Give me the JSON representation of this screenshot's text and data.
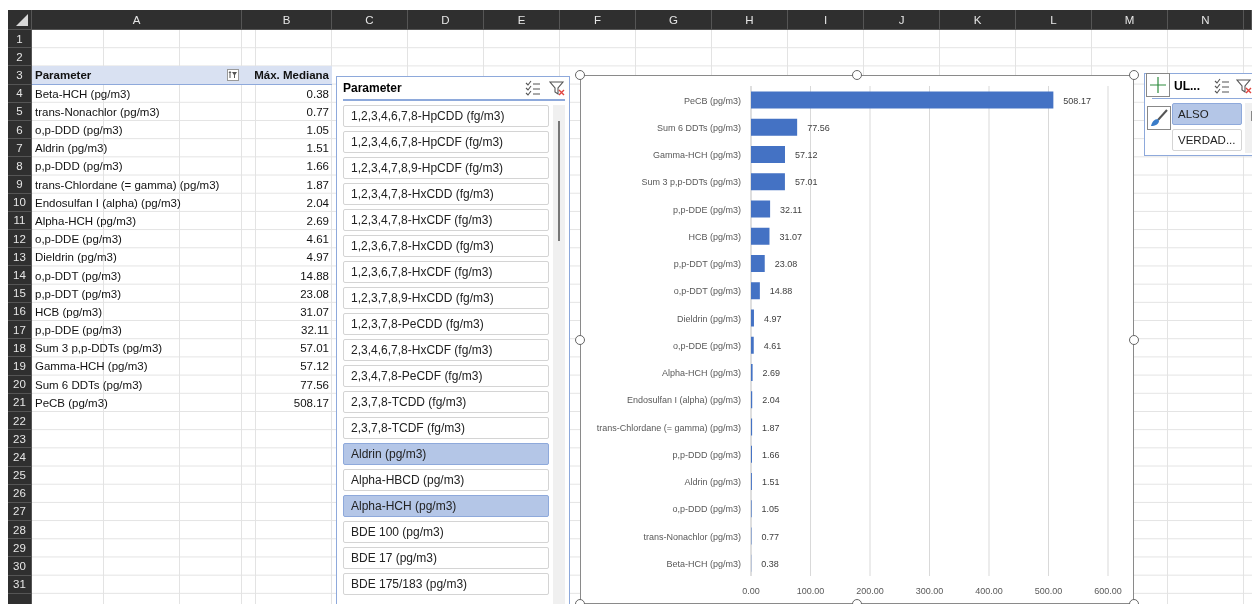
{
  "sheet": {
    "columns": [
      "A",
      "B",
      "C",
      "D",
      "E",
      "F",
      "G",
      "H",
      "I",
      "J",
      "K",
      "L",
      "M",
      "N"
    ],
    "row_numbers": [
      "1",
      "2",
      "3",
      "4",
      "5",
      "6",
      "7",
      "8",
      "9",
      "10",
      "11",
      "12",
      "13",
      "14",
      "15",
      "16",
      "17",
      "18",
      "19",
      "20",
      "21",
      "22",
      "23",
      "24",
      "25",
      "26",
      "27",
      "28",
      "29",
      "30",
      "31"
    ]
  },
  "table": {
    "columns": [
      {
        "label": "Parameter",
        "filter_button": true
      },
      {
        "label": "Máx. Mediana",
        "filter_button": false
      }
    ],
    "rows": [
      [
        "Beta-HCH (pg/m3)",
        "0.38"
      ],
      [
        "trans-Nonachlor (pg/m3)",
        "0.77"
      ],
      [
        "o,p-DDD (pg/m3)",
        "1.05"
      ],
      [
        "Aldrin (pg/m3)",
        "1.51"
      ],
      [
        "p,p-DDD (pg/m3)",
        "1.66"
      ],
      [
        "trans-Chlordane (= gamma) (pg/m3)",
        "1.87"
      ],
      [
        "Endosulfan I (alpha) (pg/m3)",
        "2.04"
      ],
      [
        "Alpha-HCH (pg/m3)",
        "2.69"
      ],
      [
        "o,p-DDE (pg/m3)",
        "4.61"
      ],
      [
        "Dieldrin (pg/m3)",
        "4.97"
      ],
      [
        "o,p-DDT (pg/m3)",
        "14.88"
      ],
      [
        "p,p-DDT (pg/m3)",
        "23.08"
      ],
      [
        "HCB (pg/m3)",
        "31.07"
      ],
      [
        "p,p-DDE (pg/m3)",
        "32.11"
      ],
      [
        "Sum 3 p,p-DDTs (pg/m3)",
        "57.01"
      ],
      [
        "Gamma-HCH (pg/m3)",
        "57.12"
      ],
      [
        "Sum 6 DDTs (pg/m3)",
        "77.56"
      ],
      [
        "PeCB (pg/m3)",
        "508.17"
      ]
    ]
  },
  "slicer": {
    "title": "Parameter",
    "items": [
      {
        "label": "1,2,3,4,6,7,8-HpCDD (fg/m3)",
        "selected": false
      },
      {
        "label": "1,2,3,4,6,7,8-HpCDF (fg/m3)",
        "selected": false
      },
      {
        "label": "1,2,3,4,7,8,9-HpCDF (fg/m3)",
        "selected": false
      },
      {
        "label": "1,2,3,4,7,8-HxCDD (fg/m3)",
        "selected": false
      },
      {
        "label": "1,2,3,4,7,8-HxCDF (fg/m3)",
        "selected": false
      },
      {
        "label": "1,2,3,6,7,8-HxCDD (fg/m3)",
        "selected": false
      },
      {
        "label": "1,2,3,6,7,8-HxCDF (fg/m3)",
        "selected": false
      },
      {
        "label": "1,2,3,7,8,9-HxCDD (fg/m3)",
        "selected": false
      },
      {
        "label": "1,2,3,7,8-PeCDD (fg/m3)",
        "selected": false
      },
      {
        "label": "2,3,4,6,7,8-HxCDF (fg/m3)",
        "selected": false
      },
      {
        "label": "2,3,4,7,8-PeCDF (fg/m3)",
        "selected": false
      },
      {
        "label": "2,3,7,8-TCDD (fg/m3)",
        "selected": false
      },
      {
        "label": "2,3,7,8-TCDF (fg/m3)",
        "selected": false
      },
      {
        "label": "Aldrin (pg/m3)",
        "selected": true
      },
      {
        "label": "Alpha-HBCD (pg/m3)",
        "selected": false
      },
      {
        "label": "Alpha-HCH (pg/m3)",
        "selected": true
      },
      {
        "label": "BDE 100 (pg/m3)",
        "selected": false
      },
      {
        "label": "BDE 17 (pg/m3)",
        "selected": false
      },
      {
        "label": "BDE 175/183 (pg/m3)",
        "selected": false
      }
    ]
  },
  "chart": {
    "selected": true,
    "chart_data": {
      "type": "bar",
      "orientation": "horizontal",
      "data_labels": true,
      "grid": true,
      "xlim": [
        0,
        600
      ],
      "xticks": [
        {
          "value": 0,
          "label": "0.00"
        },
        {
          "value": 100,
          "label": "100.00"
        },
        {
          "value": 200,
          "label": "200.00"
        },
        {
          "value": 300,
          "label": "300.00"
        },
        {
          "value": 400,
          "label": "400.00"
        },
        {
          "value": 500,
          "label": "500.00"
        },
        {
          "value": 600,
          "label": "600.00"
        }
      ],
      "categories": [
        "PeCB (pg/m3)",
        "Sum 6 DDTs (pg/m3)",
        "Gamma-HCH (pg/m3)",
        "Sum 3 p,p-DDTs (pg/m3)",
        "p,p-DDE (pg/m3)",
        "HCB (pg/m3)",
        "p,p-DDT (pg/m3)",
        "o,p-DDT (pg/m3)",
        "Dieldrin (pg/m3)",
        "o,p-DDE (pg/m3)",
        "Alpha-HCH (pg/m3)",
        "Endosulfan I (alpha) (pg/m3)",
        "trans-Chlordane (= gamma) (pg/m3)",
        "p,p-DDD (pg/m3)",
        "Aldrin (pg/m3)",
        "o,p-DDD (pg/m3)",
        "trans-Nonachlor (pg/m3)",
        "Beta-HCH (pg/m3)"
      ],
      "values": [
        508.17,
        77.56,
        57.12,
        57.01,
        32.11,
        31.07,
        23.08,
        14.88,
        4.97,
        4.61,
        2.69,
        2.04,
        1.87,
        1.66,
        1.51,
        1.05,
        0.77,
        0.38
      ]
    }
  },
  "slicer_2": {
    "title": "UL...",
    "items": [
      {
        "label": "ALSO",
        "selected": true
      },
      {
        "label": "VERDAD...",
        "selected": false
      }
    ]
  }
}
